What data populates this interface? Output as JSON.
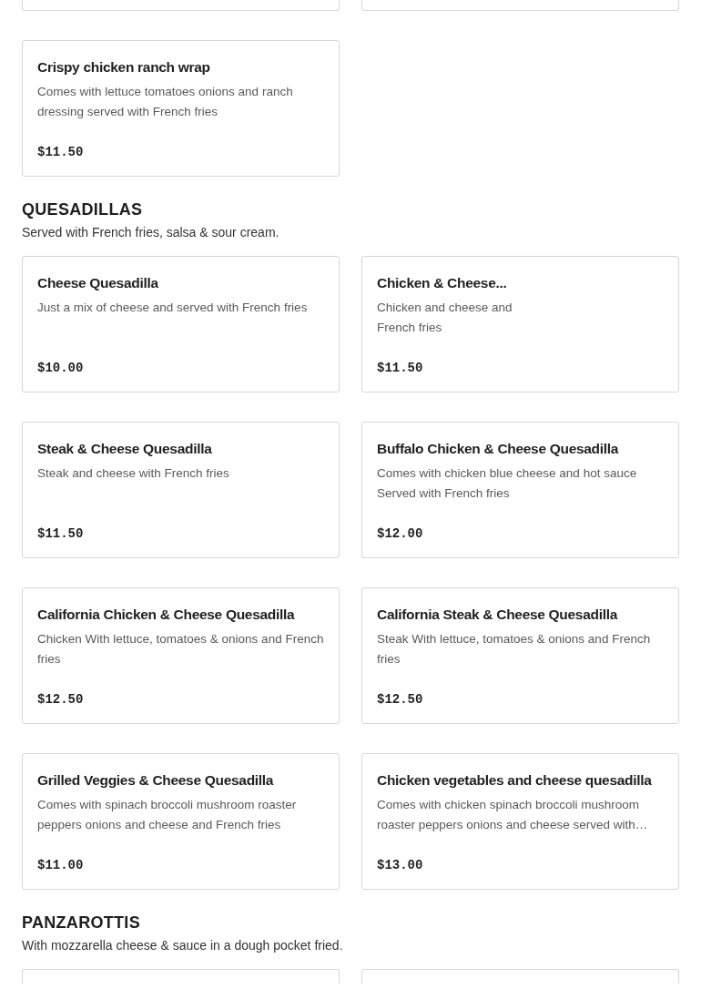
{
  "top_cards": [
    {
      "kind": "fragment"
    },
    {
      "kind": "fragment"
    }
  ],
  "leftover_items": [
    {
      "name": "Crispy chicken ranch wrap",
      "description": "Comes with lettuce tomatoes onions and ranch dressing served with French fries",
      "price": "$11.50"
    }
  ],
  "sections": [
    {
      "title": "QUESADILLAS",
      "subtitle": "Served with French fries, salsa & sour cream.",
      "items": [
        {
          "name": "Cheese Quesadilla",
          "description": "Just a mix of cheese and served with French fries",
          "price": "$10.00"
        },
        {
          "name": "Chicken & Cheese...",
          "description": "Chicken and cheese and\nFrench fries",
          "price": "$11.50"
        },
        {
          "name": "Steak & Cheese Quesadilla",
          "description": "Steak and cheese with French fries",
          "price": "$11.50"
        },
        {
          "name": "Buffalo Chicken & Cheese Quesadilla",
          "description": "Comes with chicken blue cheese and hot sauce Served with French fries",
          "price": "$12.00"
        },
        {
          "name": "California Chicken & Cheese Quesadilla",
          "description": "Chicken With lettuce, tomatoes & onions and French fries",
          "price": "$12.50"
        },
        {
          "name": "California Steak & Cheese Quesadilla",
          "description": "Steak With lettuce, tomatoes & onions and French fries",
          "price": "$12.50"
        },
        {
          "name": "Grilled Veggies & Cheese Quesadilla",
          "description": "Comes with spinach broccoli mushroom roaster peppers onions and cheese and French fries",
          "price": "$11.00"
        },
        {
          "name": "Chicken vegetables and cheese quesadilla",
          "description": "Comes with chicken spinach broccoli mushroom roaster peppers onions and cheese served with…",
          "price": "$13.00"
        }
      ]
    },
    {
      "title": "PANZAROTTIS",
      "subtitle": "With mozzarella cheese & sauce in a dough pocket fried."
    }
  ],
  "bottom_cards": [
    {
      "kind": "fragment"
    },
    {
      "kind": "fragment"
    }
  ]
}
